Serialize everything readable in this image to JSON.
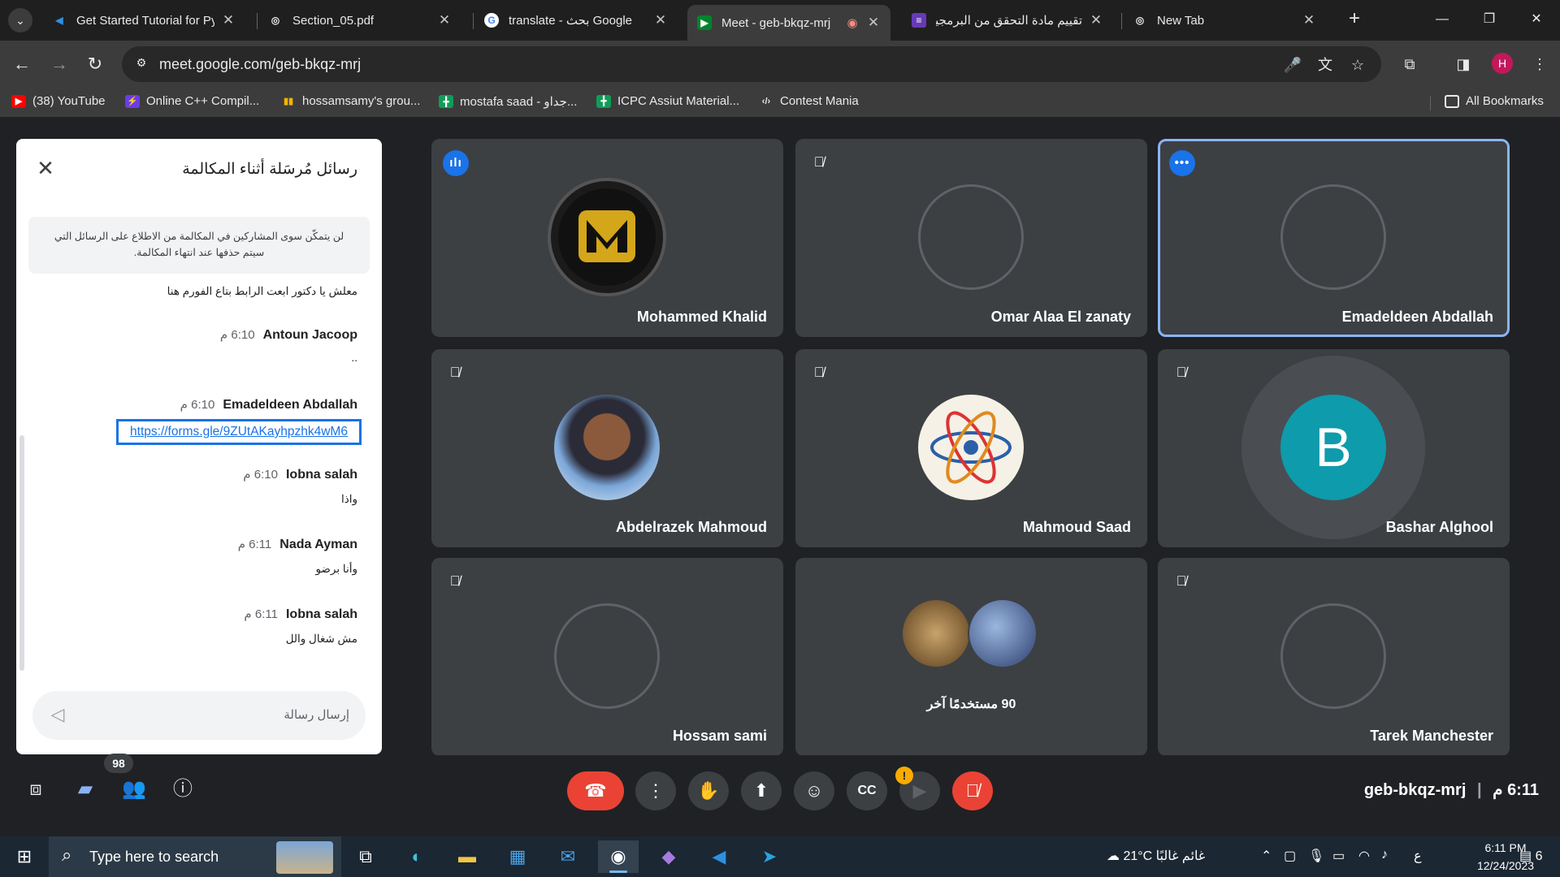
{
  "browser": {
    "tabs": [
      {
        "title": "Get Started Tutorial for Pyt",
        "favicon": "vscode-icon",
        "active": false
      },
      {
        "title": "Section_05.pdf",
        "favicon": "globe-icon",
        "active": false
      },
      {
        "title": "translate - بحث Google",
        "favicon": "google-icon",
        "active": false
      },
      {
        "title": "Meet - geb-bkqz-mrj",
        "favicon": "meet-icon",
        "active": true
      },
      {
        "title": "تقييم مادة التحقق من البرمجيات",
        "favicon": "forms-icon",
        "active": false
      },
      {
        "title": "New Tab",
        "favicon": "chrome-icon",
        "active": false
      }
    ],
    "url": "meet.google.com/geb-bkqz-mrj",
    "profile_initial": "H",
    "bookmarks": [
      {
        "label": "(38) YouTube",
        "icon": "youtube-icon"
      },
      {
        "label": "Online C++ Compil...",
        "icon": "bolt-icon"
      },
      {
        "label": "hossamsamy's grou...",
        "icon": "bar-chart-icon"
      },
      {
        "label": "mostafa saad - جداو...",
        "icon": "sheets-icon"
      },
      {
        "label": "ICPC Assiut Material...",
        "icon": "sheets-icon"
      },
      {
        "label": "Contest Mania",
        "icon": "code-icon"
      }
    ],
    "all_bookmarks": "All Bookmarks"
  },
  "chat": {
    "title": "رسائل مُرسَلة أثناء المكالمة",
    "note": "لن يتمكّن سوى المشاركين في المكالمة من الاطلاع على الرسائل التي سيتم حذفها عند انتهاء المكالمة.",
    "messages": [
      {
        "sender": "",
        "time": "",
        "text": "معلش يا دكتور ابعت الرابط بتاع الفورم هنا"
      },
      {
        "sender": "Antoun Jacoop",
        "time": "6:10 م",
        "text": ".."
      },
      {
        "sender": "Emadeldeen Abdallah",
        "time": "6:10 م",
        "text": "https://forms.gle/9ZUtAKayhpzhk4wM6"
      },
      {
        "sender": "Iobna salah",
        "time": "6:10 م",
        "text": "واذا"
      },
      {
        "sender": "Nada Ayman",
        "time": "6:11 م",
        "text": "وأنا برضو"
      },
      {
        "sender": "Iobna salah",
        "time": "6:11 م",
        "text": "مش شغال والل"
      }
    ],
    "input_placeholder": "إرسال رسالة"
  },
  "participants": [
    {
      "name": "Mohammed Khalid",
      "status": "speaking",
      "avatar": "logo-m"
    },
    {
      "name": "Omar Alaa El zanaty",
      "status": "muted",
      "avatar": "empty"
    },
    {
      "name": "Emadeldeen Abdallah",
      "status": "more",
      "avatar": "empty"
    },
    {
      "name": "Abdelrazek Mahmoud",
      "status": "muted",
      "avatar": "photo"
    },
    {
      "name": "Mahmoud Saad",
      "status": "muted",
      "avatar": "atom"
    },
    {
      "name": "Bashar Alghool",
      "status": "muted",
      "avatar": "B",
      "avatar_color": "#0e9bac"
    },
    {
      "name": "Hossam sami",
      "status": "muted",
      "avatar": "empty"
    },
    {
      "name": "",
      "status": "none",
      "avatar": "group",
      "others_label": "90 مستخدمًا آخر"
    },
    {
      "name": "Tarek Manchester",
      "status": "muted",
      "avatar": "empty"
    }
  ],
  "bottombar": {
    "people_count": "98",
    "meeting_code": "geb-bkqz-mrj",
    "time": "6:11 م"
  },
  "taskbar": {
    "search_placeholder": "Type here to search",
    "weather": "21°C  غائم غالبًا",
    "lang": "ع",
    "time": "6:11 PM",
    "date": "12/24/2023",
    "notifications": "6"
  },
  "colors": {
    "accent": "#1a73e8",
    "danger": "#ea4335",
    "tile_bg": "#3c4043",
    "meet_bg": "#202124"
  }
}
